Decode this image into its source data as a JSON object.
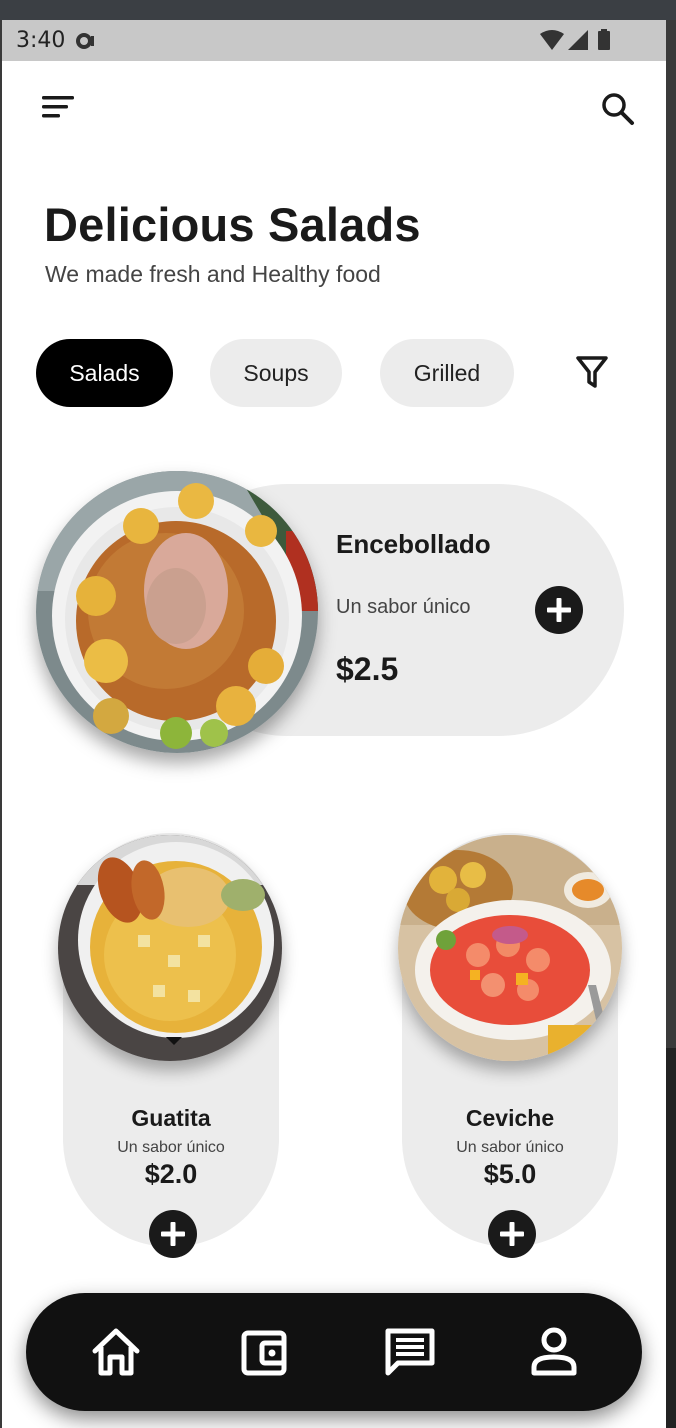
{
  "status_bar": {
    "time": "3:40"
  },
  "header": {
    "title": "Delicious Salads",
    "subtitle": "We made fresh and Healthy food"
  },
  "categories": [
    {
      "label": "Salads",
      "active": true
    },
    {
      "label": "Soups",
      "active": false
    },
    {
      "label": "Grilled",
      "active": false
    }
  ],
  "featured": {
    "name": "Encebollado",
    "subtitle": "Un sabor único",
    "price": "$2.5"
  },
  "items": [
    {
      "name": "Guatita",
      "subtitle": "Un sabor único",
      "price": "$2.0"
    },
    {
      "name": "Ceviche",
      "subtitle": "Un sabor único",
      "price": "$5.0"
    }
  ],
  "icons": {
    "menu": "menu-icon",
    "search": "search-icon",
    "filter": "filter-icon",
    "add": "plus-circle-icon",
    "nav": [
      "home-icon",
      "wallet-icon",
      "message-icon",
      "user-icon"
    ]
  },
  "colors": {
    "accent": "#000000",
    "chip_inactive": "#ececec",
    "card": "#ececec",
    "nav_bg": "#111111"
  }
}
